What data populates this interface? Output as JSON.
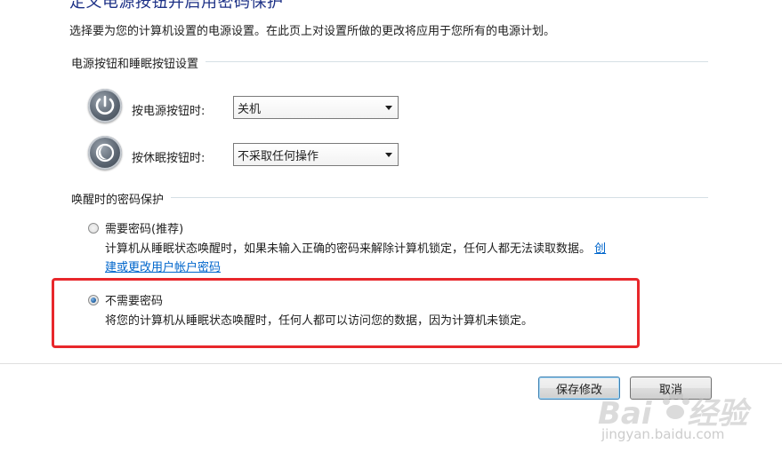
{
  "page": {
    "title": "定义电源按钮并启用密码保护",
    "description": "选择要为您的计算机设置的电源设置。在此页上对设置所做的更改将应用于您所有的电源计划。"
  },
  "power_section": {
    "title": "电源按钮和睡眠按钮设置",
    "rows": [
      {
        "label": "按电源按钮时:",
        "value": "关机",
        "icon": "power-button-icon"
      },
      {
        "label": "按休眠按钮时:",
        "value": "不采取任何操作",
        "icon": "sleep-button-icon"
      }
    ]
  },
  "password_section": {
    "title": "唤醒时的密码保护",
    "options": [
      {
        "label": "需要密码(推荐)",
        "desc_line1": "计算机从睡眠状态唤醒时，如果未输入正确的密码来解除计算机锁定，任何人都无法读取数据。",
        "link_part1": "创",
        "link_part2": "建或更改用户帐户密码",
        "checked": false
      },
      {
        "label": "不需要密码",
        "desc_line1": "将您的计算机从睡眠状态唤醒时，任何人都可以访问您的数据，因为计算机未锁定。",
        "checked": true
      }
    ]
  },
  "buttons": {
    "save": "保存修改",
    "cancel": "取消"
  },
  "watermark": {
    "brand": "Bai",
    "brand2": "经验",
    "url": "jingyan.baidu.com"
  },
  "colors": {
    "highlight_box": "#e8272b",
    "link": "#0066cc",
    "title": "#1e3287"
  }
}
